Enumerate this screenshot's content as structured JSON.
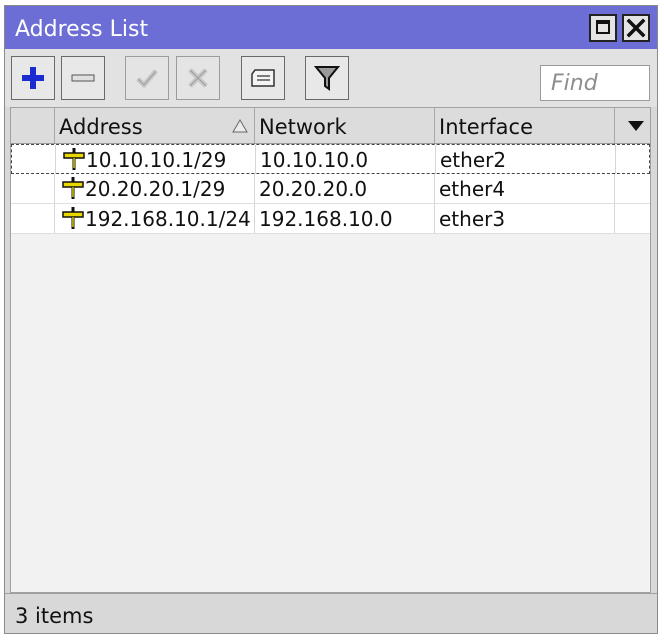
{
  "window": {
    "title": "Address List"
  },
  "toolbar": {
    "add": "add-icon",
    "remove": "remove-icon",
    "enable": "check-icon",
    "disable": "x-icon",
    "comment": "comment-icon",
    "filter": "filter-icon",
    "find_placeholder": "Find"
  },
  "table": {
    "columns": [
      "Address",
      "Network",
      "Interface"
    ],
    "rows": [
      {
        "address": "10.10.10.1/29",
        "network": "10.10.10.0",
        "interface": "ether2"
      },
      {
        "address": "20.20.20.1/29",
        "network": "20.20.20.0",
        "interface": "ether4"
      },
      {
        "address": "192.168.10.1/24",
        "network": "192.168.10.0",
        "interface": "ether3"
      }
    ]
  },
  "status": {
    "items": "3 items"
  },
  "colors": {
    "titlebar": "#6d6dd6",
    "add_icon": "#1a2bd0",
    "address_icon": "#e8d800"
  }
}
